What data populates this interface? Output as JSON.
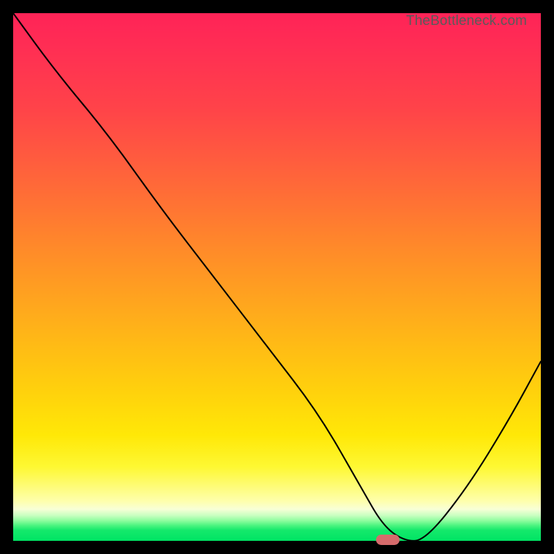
{
  "watermark": "TheBottleneck.com",
  "chart_data": {
    "type": "line",
    "title": "",
    "xlabel": "",
    "ylabel": "",
    "xlim": [
      0,
      100
    ],
    "ylim": [
      0,
      100
    ],
    "series": [
      {
        "name": "bottleneck-curve",
        "x": [
          0,
          8,
          18,
          28,
          38,
          48,
          58,
          66,
          70,
          74,
          78,
          86,
          94,
          100
        ],
        "y": [
          100,
          89,
          77,
          63,
          50,
          37,
          24,
          10,
          3,
          0,
          0,
          10,
          23,
          34
        ]
      }
    ],
    "marker": {
      "x": 71,
      "y": 0
    },
    "gradient_stops": [
      {
        "pos": 0,
        "color": "#ff2357"
      },
      {
        "pos": 50,
        "color": "#ff9824"
      },
      {
        "pos": 85,
        "color": "#fef636"
      },
      {
        "pos": 100,
        "color": "#00e464"
      }
    ]
  }
}
